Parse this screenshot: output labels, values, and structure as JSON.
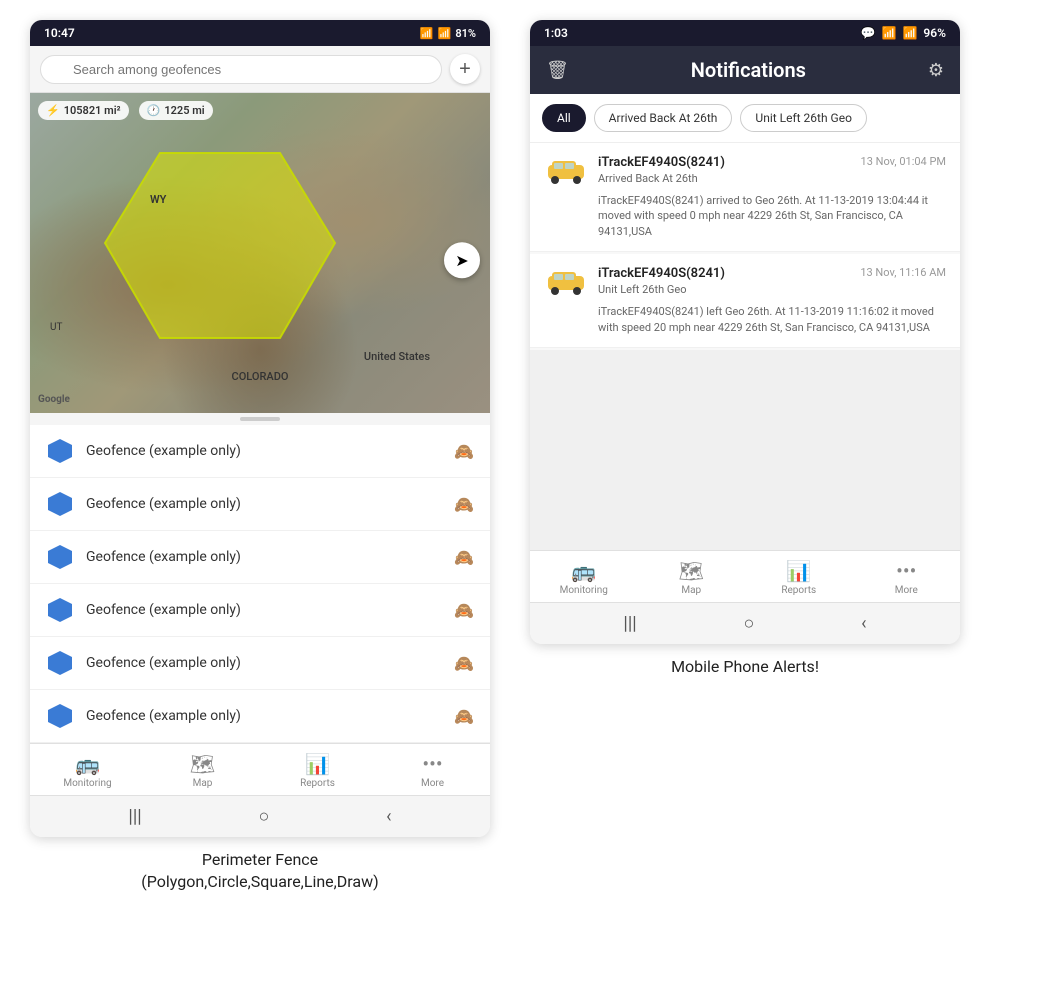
{
  "left_phone": {
    "status_bar": {
      "time": "10:47",
      "wifi": "WiFi",
      "signal": "Signal",
      "battery": "81%"
    },
    "search": {
      "placeholder": "Search among geofences"
    },
    "map": {
      "stat1": "105821 mi²",
      "stat2": "1225 mi",
      "label_wy": "WY",
      "label_ut": "UT",
      "label_us": "United States",
      "label_colorado": "COLORADO"
    },
    "geofence_items": [
      {
        "label": "Geofence (example only)"
      },
      {
        "label": "Geofence (example only)"
      },
      {
        "label": "Geofence (example only)"
      },
      {
        "label": "Geofence (example only)"
      },
      {
        "label": "Geofence (example only)"
      },
      {
        "label": "Geofence (example only)"
      }
    ],
    "nav": {
      "items": [
        {
          "label": "Monitoring",
          "icon": "🚌"
        },
        {
          "label": "Map",
          "icon": "🗺"
        },
        {
          "label": "Reports",
          "icon": "📊"
        },
        {
          "label": "More",
          "icon": "•••"
        }
      ]
    },
    "caption": "Perimeter Fence\n(Polygon,Circle,Square,Line,Draw)"
  },
  "right_phone": {
    "status_bar": {
      "time": "1:03",
      "battery": "96%"
    },
    "header": {
      "title": "Notifications",
      "delete_icon": "trash",
      "settings_icon": "gear"
    },
    "filters": [
      {
        "label": "All",
        "active": true
      },
      {
        "label": "Arrived Back At 26th",
        "active": false
      },
      {
        "label": "Unit Left 26th Geo",
        "active": false
      }
    ],
    "notifications": [
      {
        "device": "iTrackEF4940S(8241)",
        "time": "13 Nov, 01:04 PM",
        "event": "Arrived Back At 26th",
        "desc": "iTrackEF4940S(8241) arrived to Geo 26th.    At 11-13-2019 13:04:44 it moved with speed 0 mph near 4229 26th St, San Francisco, CA 94131,USA"
      },
      {
        "device": "iTrackEF4940S(8241)",
        "time": "13 Nov, 11:16 AM",
        "event": "Unit Left 26th Geo",
        "desc": "iTrackEF4940S(8241) left Geo 26th.    At 11-13-2019 11:16:02 it moved with speed 20 mph near 4229 26th St, San Francisco, CA 94131,USA"
      }
    ],
    "nav": {
      "items": [
        {
          "label": "Monitoring",
          "icon": "🚌"
        },
        {
          "label": "Map",
          "icon": "🗺"
        },
        {
          "label": "Reports",
          "icon": "📊"
        },
        {
          "label": "More",
          "icon": "•••"
        }
      ]
    },
    "caption": "Mobile Phone Alerts!"
  }
}
